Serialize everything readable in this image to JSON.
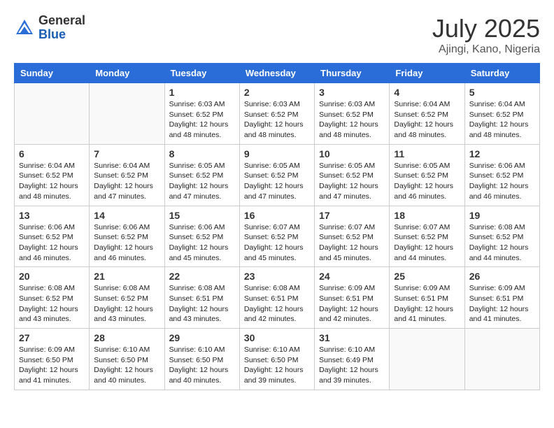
{
  "header": {
    "logo_general": "General",
    "logo_blue": "Blue",
    "month_year": "July 2025",
    "location": "Ajingi, Kano, Nigeria"
  },
  "weekdays": [
    "Sunday",
    "Monday",
    "Tuesday",
    "Wednesday",
    "Thursday",
    "Friday",
    "Saturday"
  ],
  "weeks": [
    [
      {
        "day": "",
        "info": ""
      },
      {
        "day": "",
        "info": ""
      },
      {
        "day": "1",
        "info": "Sunrise: 6:03 AM\nSunset: 6:52 PM\nDaylight: 12 hours and 48 minutes."
      },
      {
        "day": "2",
        "info": "Sunrise: 6:03 AM\nSunset: 6:52 PM\nDaylight: 12 hours and 48 minutes."
      },
      {
        "day": "3",
        "info": "Sunrise: 6:03 AM\nSunset: 6:52 PM\nDaylight: 12 hours and 48 minutes."
      },
      {
        "day": "4",
        "info": "Sunrise: 6:04 AM\nSunset: 6:52 PM\nDaylight: 12 hours and 48 minutes."
      },
      {
        "day": "5",
        "info": "Sunrise: 6:04 AM\nSunset: 6:52 PM\nDaylight: 12 hours and 48 minutes."
      }
    ],
    [
      {
        "day": "6",
        "info": "Sunrise: 6:04 AM\nSunset: 6:52 PM\nDaylight: 12 hours and 48 minutes."
      },
      {
        "day": "7",
        "info": "Sunrise: 6:04 AM\nSunset: 6:52 PM\nDaylight: 12 hours and 47 minutes."
      },
      {
        "day": "8",
        "info": "Sunrise: 6:05 AM\nSunset: 6:52 PM\nDaylight: 12 hours and 47 minutes."
      },
      {
        "day": "9",
        "info": "Sunrise: 6:05 AM\nSunset: 6:52 PM\nDaylight: 12 hours and 47 minutes."
      },
      {
        "day": "10",
        "info": "Sunrise: 6:05 AM\nSunset: 6:52 PM\nDaylight: 12 hours and 47 minutes."
      },
      {
        "day": "11",
        "info": "Sunrise: 6:05 AM\nSunset: 6:52 PM\nDaylight: 12 hours and 46 minutes."
      },
      {
        "day": "12",
        "info": "Sunrise: 6:06 AM\nSunset: 6:52 PM\nDaylight: 12 hours and 46 minutes."
      }
    ],
    [
      {
        "day": "13",
        "info": "Sunrise: 6:06 AM\nSunset: 6:52 PM\nDaylight: 12 hours and 46 minutes."
      },
      {
        "day": "14",
        "info": "Sunrise: 6:06 AM\nSunset: 6:52 PM\nDaylight: 12 hours and 46 minutes."
      },
      {
        "day": "15",
        "info": "Sunrise: 6:06 AM\nSunset: 6:52 PM\nDaylight: 12 hours and 45 minutes."
      },
      {
        "day": "16",
        "info": "Sunrise: 6:07 AM\nSunset: 6:52 PM\nDaylight: 12 hours and 45 minutes."
      },
      {
        "day": "17",
        "info": "Sunrise: 6:07 AM\nSunset: 6:52 PM\nDaylight: 12 hours and 45 minutes."
      },
      {
        "day": "18",
        "info": "Sunrise: 6:07 AM\nSunset: 6:52 PM\nDaylight: 12 hours and 44 minutes."
      },
      {
        "day": "19",
        "info": "Sunrise: 6:08 AM\nSunset: 6:52 PM\nDaylight: 12 hours and 44 minutes."
      }
    ],
    [
      {
        "day": "20",
        "info": "Sunrise: 6:08 AM\nSunset: 6:52 PM\nDaylight: 12 hours and 43 minutes."
      },
      {
        "day": "21",
        "info": "Sunrise: 6:08 AM\nSunset: 6:52 PM\nDaylight: 12 hours and 43 minutes."
      },
      {
        "day": "22",
        "info": "Sunrise: 6:08 AM\nSunset: 6:51 PM\nDaylight: 12 hours and 43 minutes."
      },
      {
        "day": "23",
        "info": "Sunrise: 6:08 AM\nSunset: 6:51 PM\nDaylight: 12 hours and 42 minutes."
      },
      {
        "day": "24",
        "info": "Sunrise: 6:09 AM\nSunset: 6:51 PM\nDaylight: 12 hours and 42 minutes."
      },
      {
        "day": "25",
        "info": "Sunrise: 6:09 AM\nSunset: 6:51 PM\nDaylight: 12 hours and 41 minutes."
      },
      {
        "day": "26",
        "info": "Sunrise: 6:09 AM\nSunset: 6:51 PM\nDaylight: 12 hours and 41 minutes."
      }
    ],
    [
      {
        "day": "27",
        "info": "Sunrise: 6:09 AM\nSunset: 6:50 PM\nDaylight: 12 hours and 41 minutes."
      },
      {
        "day": "28",
        "info": "Sunrise: 6:10 AM\nSunset: 6:50 PM\nDaylight: 12 hours and 40 minutes."
      },
      {
        "day": "29",
        "info": "Sunrise: 6:10 AM\nSunset: 6:50 PM\nDaylight: 12 hours and 40 minutes."
      },
      {
        "day": "30",
        "info": "Sunrise: 6:10 AM\nSunset: 6:50 PM\nDaylight: 12 hours and 39 minutes."
      },
      {
        "day": "31",
        "info": "Sunrise: 6:10 AM\nSunset: 6:49 PM\nDaylight: 12 hours and 39 minutes."
      },
      {
        "day": "",
        "info": ""
      },
      {
        "day": "",
        "info": ""
      }
    ]
  ]
}
